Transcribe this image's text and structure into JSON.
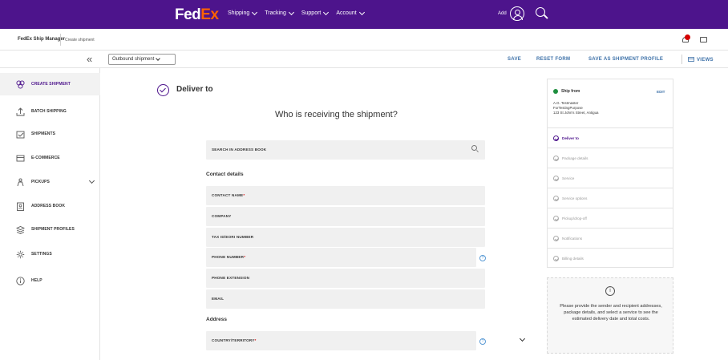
{
  "header": {
    "logo_fed": "Fed",
    "logo_ex": "Ex",
    "nav": [
      "Shipping",
      "Tracking",
      "Support",
      "Account"
    ],
    "add_label": "Add"
  },
  "subbar": {
    "app_name": "FedEx Ship Manager",
    "breadcrumb": "Create shipment"
  },
  "toolbar": {
    "collapse_glyph": "«",
    "shipment_type": "Outbound shipment",
    "save": "SAVE",
    "reset": "RESET FORM",
    "save_profile": "SAVE AS SHIPMENT PROFILE",
    "views": "VIEWS"
  },
  "sidebar": {
    "items": [
      {
        "label": "CREATE SHIPMENT",
        "icon": "create-shipment-icon"
      },
      {
        "label": "BATCH SHIPPING",
        "icon": "batch-upload-icon"
      },
      {
        "label": "SHIPMENTS",
        "icon": "shipments-icon"
      },
      {
        "label": "E-COMMERCE",
        "icon": "ecommerce-icon"
      },
      {
        "label": "PICKUPS",
        "icon": "pickup-icon"
      },
      {
        "label": "ADDRESS BOOK",
        "icon": "address-book-icon"
      },
      {
        "label": "SHIPMENT PROFILES",
        "icon": "profiles-icon"
      },
      {
        "label": "SETTINGS",
        "icon": "gear-icon"
      },
      {
        "label": "HELP",
        "icon": "help-icon"
      }
    ]
  },
  "form": {
    "title": "Deliver to",
    "question": "Who is receiving the shipment?",
    "search_placeholder": "SEARCH IN ADDRESS BOOK",
    "contact_heading": "Contact details",
    "fields": {
      "contact_name": "CONTACT NAME",
      "company": "COMPANY",
      "tax_id": "TAX ID/EORI NUMBER",
      "phone": "PHONE NUMBER",
      "phone_ext": "PHONE EXTENSION",
      "email": "EMAIL",
      "country": "COUNTRY/TERRITORY"
    },
    "required_mark": "*",
    "help_glyph": "?",
    "address_heading": "Address"
  },
  "summary": {
    "ship_from_title": "Ship from",
    "edit": "EDIT",
    "address_lines": [
      "A.G. Testmaster",
      "ForTestingPurpose",
      "123 St John's Street, Antigua"
    ],
    "steps": [
      "Deliver to",
      "Package details",
      "Service",
      "Service options",
      "Pickup/drop-off",
      "Notifications",
      "Billing details"
    ],
    "info_glyph": "i",
    "info_text": "Please provide the sender and recipient addresses, package details, and select a service to see the estimated delivery date and total costs."
  },
  "colors": {
    "brand_purple": "#4d148c",
    "brand_orange": "#ff6200",
    "link_blue": "#3d71a8",
    "success_green": "#1e8e3e"
  }
}
